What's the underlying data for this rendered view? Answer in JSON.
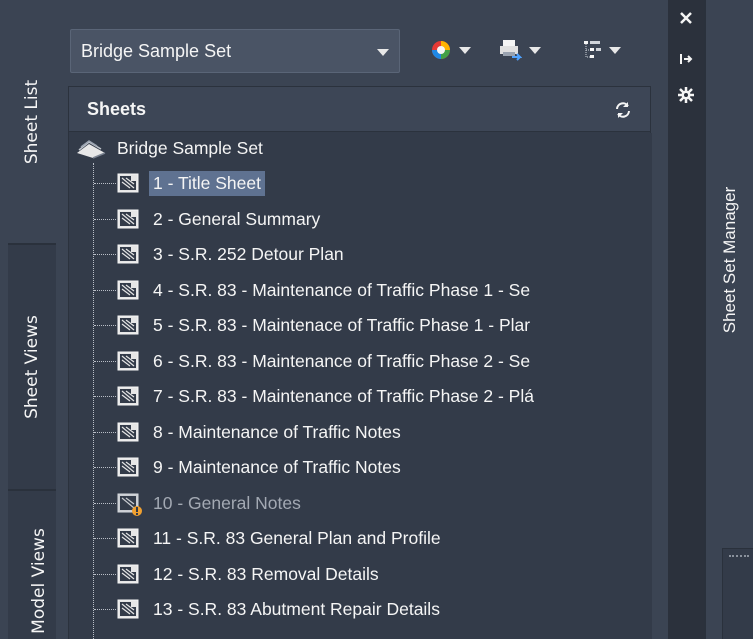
{
  "tabs": {
    "sheet_list": "Sheet List",
    "sheet_views": "Sheet Views",
    "model_views": "Model Views"
  },
  "combo": {
    "value": "Bridge Sample Set"
  },
  "toolbar": {
    "icons": [
      "color-wheel-icon",
      "publish-icon",
      "view-options-icon"
    ]
  },
  "panel": {
    "title": "Sheets"
  },
  "tree": {
    "root": "Bridge Sample Set",
    "items": [
      {
        "label": "1 - Title Sheet",
        "state": "selected"
      },
      {
        "label": "2 - General Summary",
        "state": "normal"
      },
      {
        "label": "3 - S.R. 252 Detour Plan",
        "state": "normal"
      },
      {
        "label": "4 - S.R. 83 - Maintenance of Traffic Phase 1 - Se",
        "state": "normal"
      },
      {
        "label": "5 - S.R. 83 - Maintenace of Traffic Phase 1 - Plar",
        "state": "normal"
      },
      {
        "label": "6 - S.R. 83 - Maintenance of Traffic Phase 2 - Se",
        "state": "normal"
      },
      {
        "label": "7 - S.R. 83 - Maintenance of Traffic Phase 2 - Plá",
        "state": "normal"
      },
      {
        "label": "8 - Maintenance of Traffic Notes",
        "state": "normal"
      },
      {
        "label": "9 - Maintenance of Traffic Notes",
        "state": "normal"
      },
      {
        "label": "10 - General Notes",
        "state": "dim"
      },
      {
        "label": "11 - S.R. 83 General Plan and Profile",
        "state": "normal"
      },
      {
        "label": "12 - S.R. 83 Removal Details",
        "state": "normal"
      },
      {
        "label": "13 - S.R. 83 Abutment Repair Details",
        "state": "normal"
      }
    ]
  },
  "palette": {
    "title": "Sheet Set Manager"
  },
  "colors": {
    "background": "#3b4453",
    "panel": "#333b49",
    "selection": "#5f7291",
    "warning": "#f0a030"
  }
}
